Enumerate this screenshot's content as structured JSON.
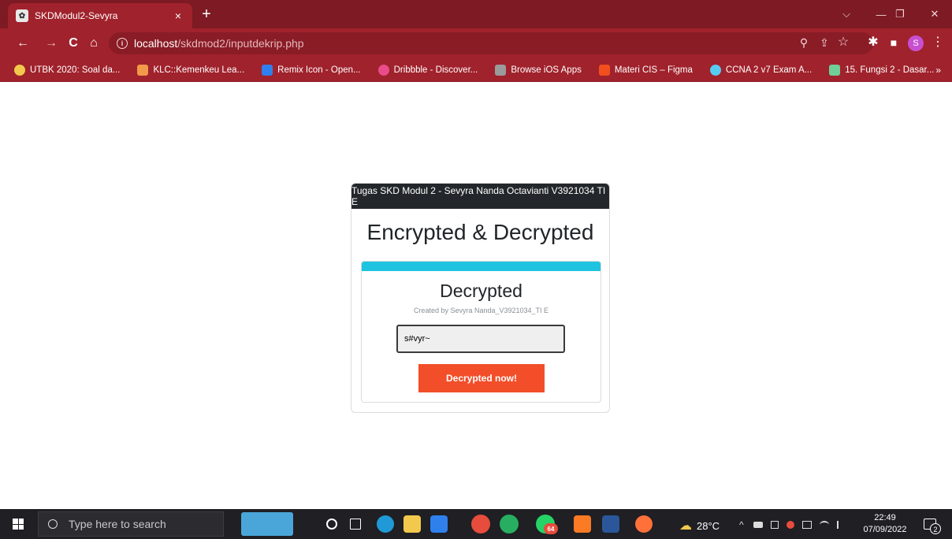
{
  "browser": {
    "tab": {
      "favicon": "✿",
      "title": "SKDModul2-Sevyra",
      "close": "×"
    },
    "new_tab": "+",
    "window_controls": {
      "tab_search": "⌵",
      "minimize": "—",
      "restore": "❐",
      "close": "✕"
    },
    "nav": {
      "back": "←",
      "forward": "→",
      "reload": "C",
      "home": "⌂"
    },
    "address": {
      "info_icon": "i",
      "host": "localhost",
      "path": "/skdmod2/inputdekrip.php"
    },
    "omnibox_icons": {
      "zoom": "⚲",
      "share": "⇪",
      "bookmark": "☆"
    },
    "toolbar_icons": {
      "extensions": "✱",
      "sidebar": "■",
      "profile": "S",
      "menu": "⋮"
    },
    "bookmarks": [
      {
        "label": "UTBK 2020: Soal da...",
        "color": "#f2c94c"
      },
      {
        "label": "KLC::Kemenkeu Lea...",
        "color": "#f2994a"
      },
      {
        "label": "Remix Icon - Open...",
        "color": "#2f80ed"
      },
      {
        "label": "Dribbble - Discover...",
        "color": "#ea4c89"
      },
      {
        "label": "Browse iOS Apps",
        "color": "#9b9b9b"
      },
      {
        "label": "Materi CIS – Figma",
        "color": "#f24e1e"
      },
      {
        "label": "CCNA 2 v7 Exam A...",
        "color": "#56ccf2"
      },
      {
        "label": "15. Fungsi 2 - Dasar...",
        "color": "#6fcf97"
      }
    ],
    "bookmarks_more": "»"
  },
  "card": {
    "header": "Tugas SKD Modul 2 - Sevyra Nanda Octavianti V3921034 TI E",
    "title": "Encrypted & Decrypted",
    "inner": {
      "title": "Decrypted",
      "subtitle": "Created by Sevyra Nanda_V3921034_TI E",
      "input_value": "s#vyr~",
      "button": "Decrypted now!"
    }
  },
  "taskbar": {
    "search_placeholder": "Type here to search",
    "apps": [
      "cortana",
      "task-view",
      "edge",
      "file-explorer",
      "vscode",
      "chrome-profile",
      "chrome",
      "whatsapp",
      "xampp",
      "word",
      "firefox"
    ],
    "whatsapp_badge": "64",
    "weather": {
      "icon": "☁",
      "temp": "28°C"
    },
    "tray": {
      "chevron": "^"
    },
    "clock": {
      "time": "22:49",
      "date": "07/09/2022"
    },
    "notifications": "2"
  }
}
